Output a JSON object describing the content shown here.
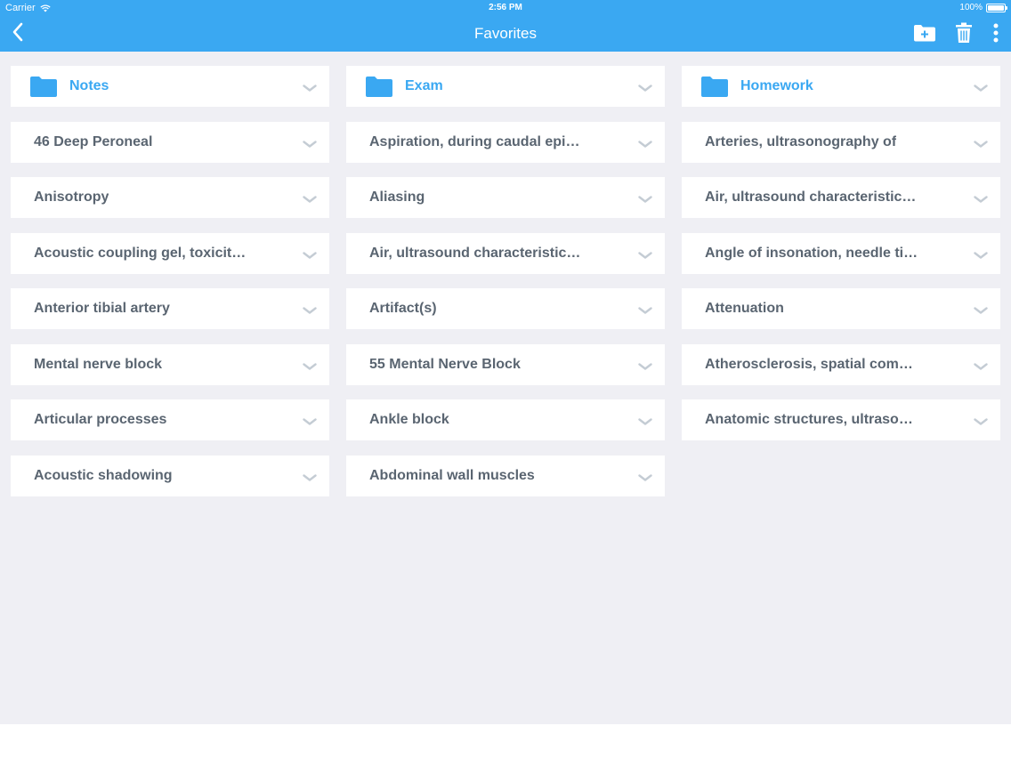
{
  "status_bar": {
    "carrier": "Carrier",
    "time": "2:56 PM",
    "battery": "100%"
  },
  "nav": {
    "title": "Favorites",
    "back_icon": "chevron-left-icon",
    "actions": [
      "add-folder-icon",
      "trash-icon",
      "more-vertical-icon"
    ]
  },
  "colors": {
    "accent": "#3aa8f2",
    "background": "#efeff4",
    "card": "#ffffff",
    "text": "#5a6571",
    "chevron": "#c4ccd4"
  },
  "columns": [
    {
      "folder": "Notes",
      "items": [
        "46 Deep Peroneal",
        "Anisotropy",
        "Acoustic coupling gel, toxicit…",
        "Anterior tibial artery",
        "Mental nerve block",
        "Articular processes",
        "Acoustic shadowing"
      ]
    },
    {
      "folder": "Exam",
      "items": [
        "Aspiration, during caudal epi…",
        "Aliasing",
        "Air, ultrasound characteristic…",
        "Artifact(s)",
        "55 Mental Nerve Block",
        "Ankle block",
        "Abdominal wall muscles"
      ]
    },
    {
      "folder": "Homework",
      "items": [
        "Arteries, ultrasonography of",
        "Air, ultrasound characteristic…",
        "Angle of insonation, needle ti…",
        "Attenuation",
        "Atherosclerosis, spatial com…",
        "Anatomic structures, ultraso…"
      ]
    }
  ]
}
